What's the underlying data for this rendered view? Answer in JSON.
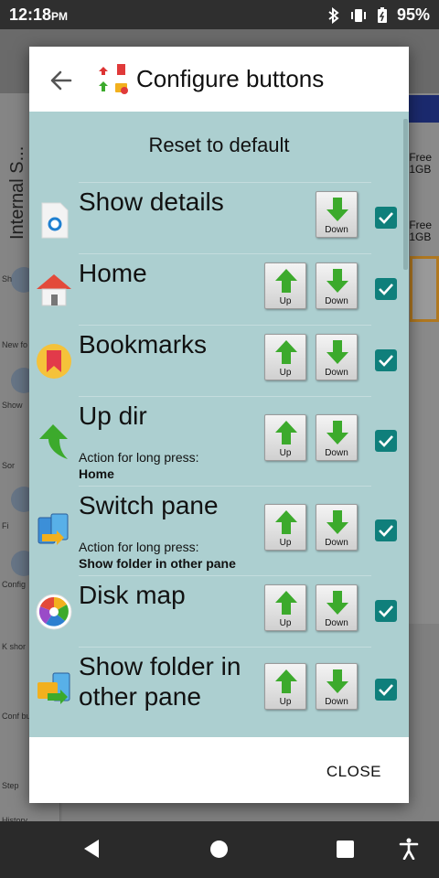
{
  "status_bar": {
    "time": "12:18",
    "ampm": "PM",
    "battery": "95%"
  },
  "background": {
    "vertical_label": "Internal S...",
    "free_1": "Free",
    "size_1": "1GB",
    "free_2": "Free",
    "size_2": "1GB",
    "side_items": [
      "Sh",
      "New fo",
      "Show",
      "Sor",
      "Fi",
      "Config",
      "K shor",
      "Conf butt",
      "Step",
      "History"
    ]
  },
  "dialog": {
    "title": "Configure buttons",
    "reset_label": "Reset to default",
    "close_label": "CLOSE",
    "up_label": "Up",
    "down_label": "Down",
    "items": [
      {
        "label": "Show details",
        "icon": "show-details-icon",
        "checked": true
      },
      {
        "label": "Home",
        "icon": "home-icon",
        "checked": true
      },
      {
        "label": "Bookmarks",
        "icon": "bookmarks-icon",
        "checked": true
      },
      {
        "label": "Up dir",
        "icon": "up-dir-icon",
        "long_press_caption": "Action for long press:",
        "long_press_value": "Home",
        "checked": true
      },
      {
        "label": "Switch pane",
        "icon": "switch-pane-icon",
        "long_press_caption": "Action for long press:",
        "long_press_value": "Show folder in other pane",
        "checked": true
      },
      {
        "label": "Disk map",
        "icon": "disk-map-icon",
        "checked": true
      },
      {
        "label": "Show folder in other pane",
        "icon": "show-folder-other-pane-icon",
        "checked": true
      }
    ]
  },
  "colors": {
    "dialog_content_bg": "#accfd0",
    "checkbox": "#0f7f7b",
    "arrow_up": "#3caa2c",
    "arrow_down": "#3caa2c"
  }
}
